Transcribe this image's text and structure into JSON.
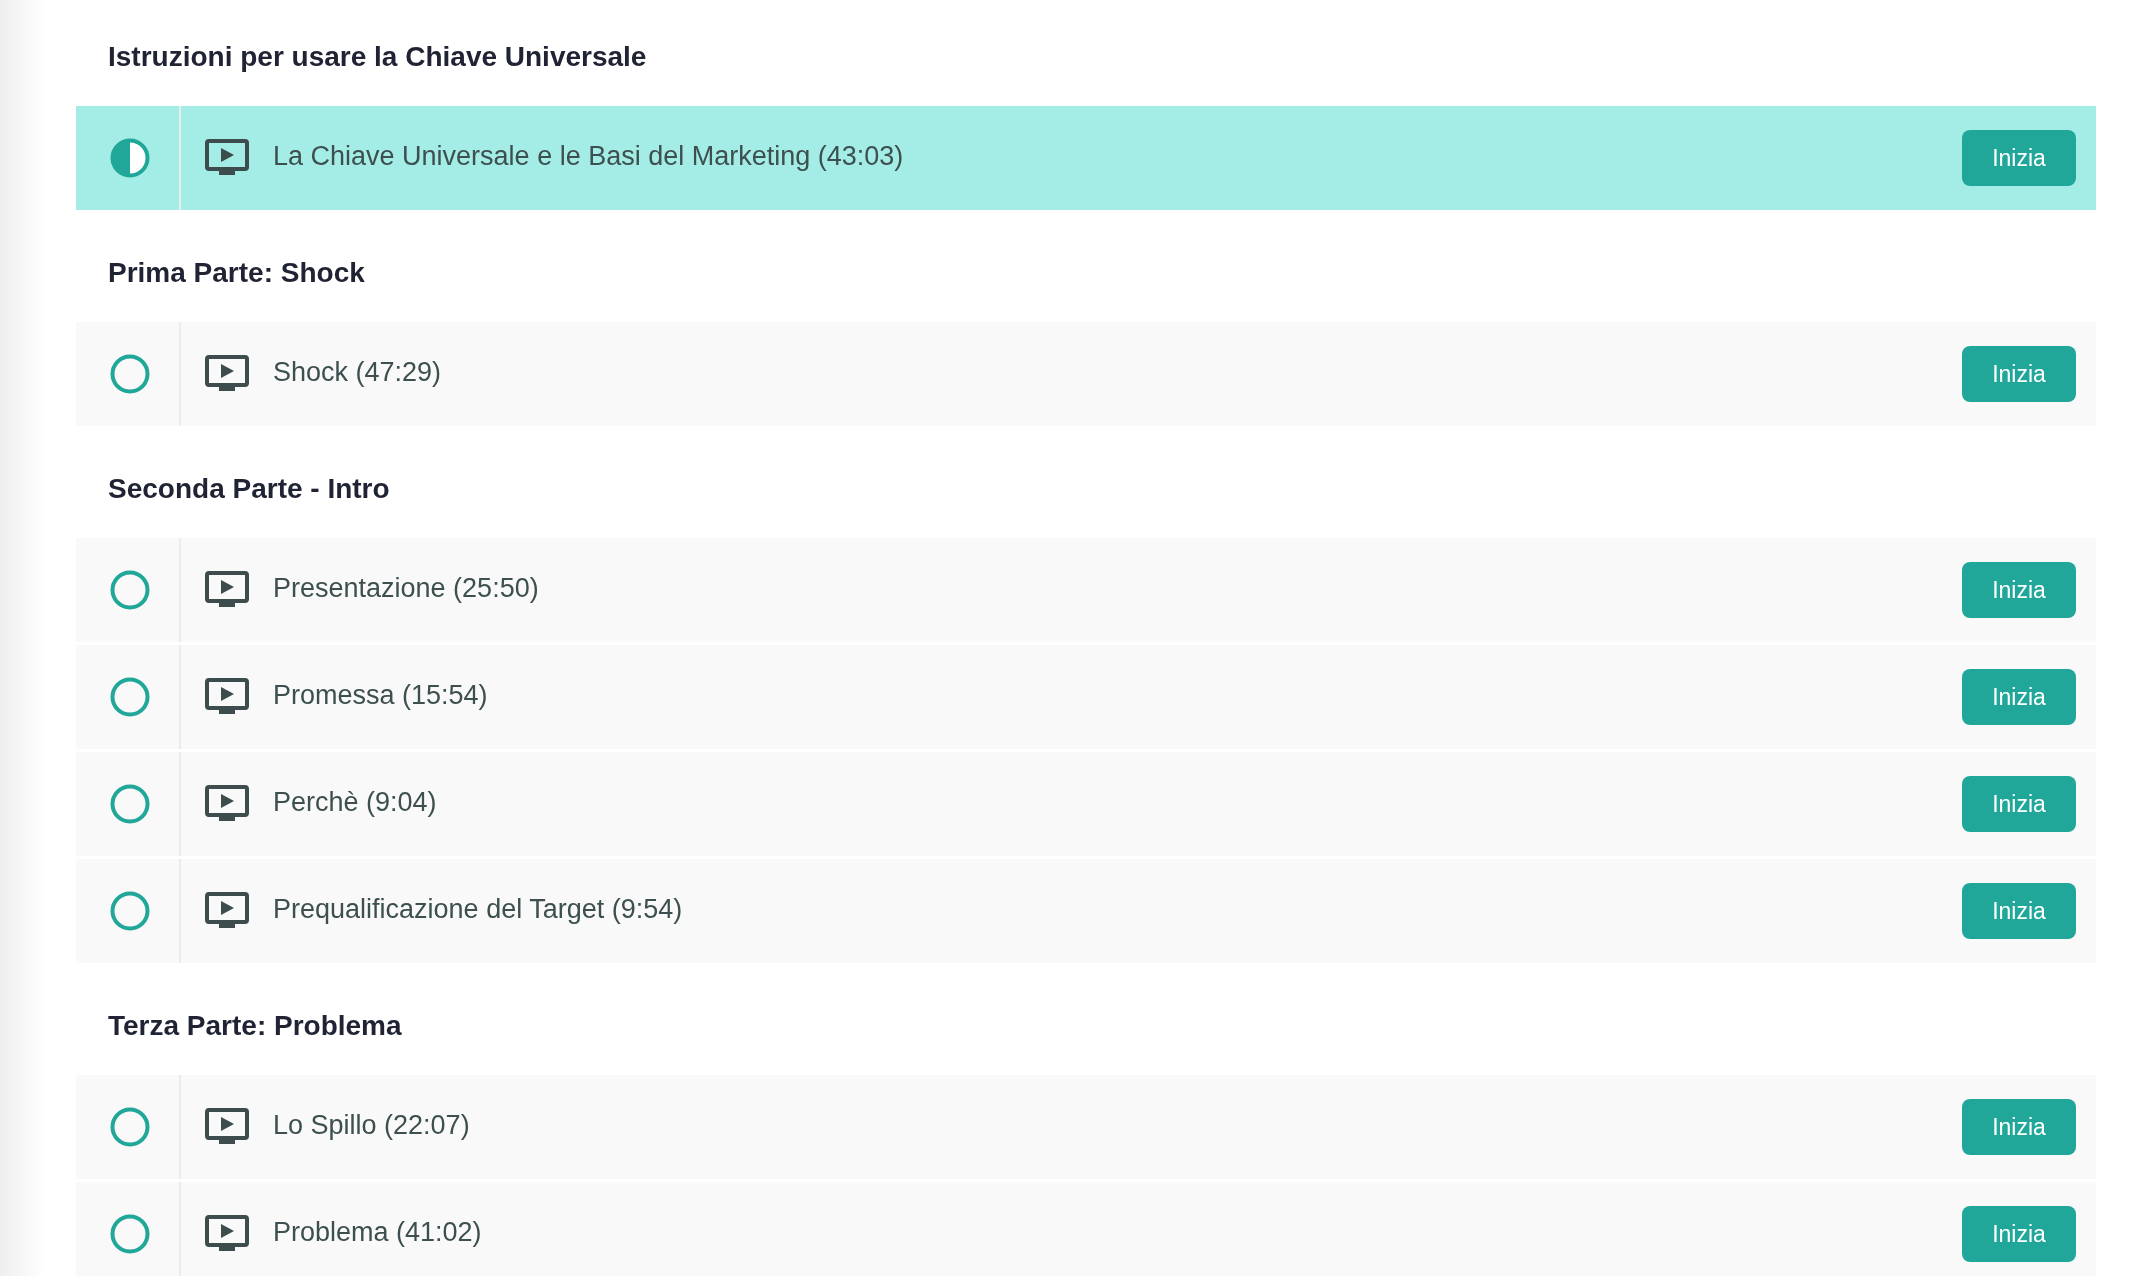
{
  "sections": [
    {
      "title": "Istruzioni per usare la Chiave Universale",
      "lessons": [
        {
          "title": "La Chiave Universale e le Basi del Marketing (43:03)",
          "started": true,
          "selected": true,
          "button": "Inizia"
        }
      ]
    },
    {
      "title": "Prima Parte: Shock",
      "lessons": [
        {
          "title": "Shock (47:29)",
          "started": false,
          "selected": false,
          "button": "Inizia"
        }
      ]
    },
    {
      "title": "Seconda Parte - Intro",
      "lessons": [
        {
          "title": "Presentazione (25:50)",
          "started": false,
          "selected": false,
          "button": "Inizia"
        },
        {
          "title": "Promessa (15:54)",
          "started": false,
          "selected": false,
          "button": "Inizia"
        },
        {
          "title": "Perchè (9:04)",
          "started": false,
          "selected": false,
          "button": "Inizia"
        },
        {
          "title": "Prequalificazione del Target (9:54)",
          "started": false,
          "selected": false,
          "button": "Inizia"
        }
      ]
    },
    {
      "title": "Terza Parte: Problema",
      "lessons": [
        {
          "title": "Lo Spillo (22:07)",
          "started": false,
          "selected": false,
          "button": "Inizia"
        },
        {
          "title": "Problema (41:02)",
          "started": false,
          "selected": false,
          "button": "Inizia"
        }
      ]
    }
  ]
}
